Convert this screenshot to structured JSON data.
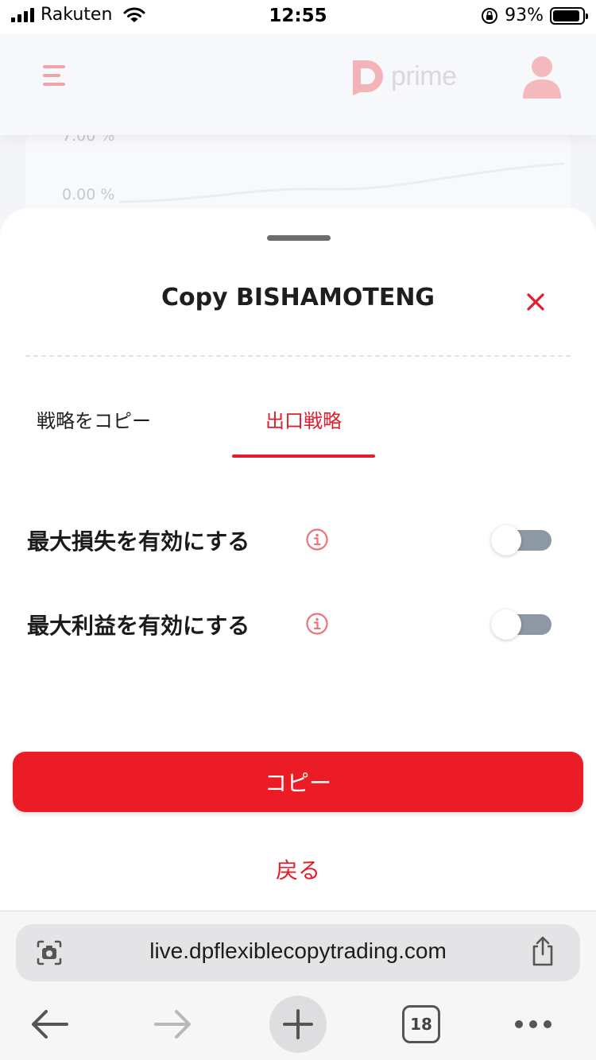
{
  "status_bar": {
    "carrier": "Rakuten",
    "time": "12:55",
    "battery_percent": "93%",
    "battery_level": 0.93,
    "icons": [
      "signal-icon",
      "wifi-icon",
      "orientation-lock-icon",
      "battery-icon"
    ]
  },
  "app_header": {
    "logo_text": "prime",
    "icons": [
      "menu-icon",
      "logo-icon",
      "user-icon"
    ]
  },
  "background_chart": {
    "axis_labels": [
      "7.00 %",
      "0.00 %"
    ]
  },
  "sheet": {
    "title": "Copy BISHAMOTENG",
    "close_icon": "close-icon",
    "tabs": [
      {
        "label": "戦略をコピー",
        "active": false
      },
      {
        "label": "出口戦略",
        "active": true
      }
    ],
    "options": [
      {
        "label": "最大損失を有効にする",
        "enabled": false,
        "info_icon": "info-icon"
      },
      {
        "label": "最大利益を有効にする",
        "enabled": false,
        "info_icon": "info-icon"
      }
    ],
    "copy_button": "コピー",
    "back_link": "戻る"
  },
  "browser": {
    "url": "live.dpflexiblecopytrading.com",
    "tab_count": "18",
    "icons": [
      "camera-search-icon",
      "share-icon",
      "back-arrow-icon",
      "forward-arrow-icon",
      "plus-icon",
      "tabs-icon",
      "more-icon"
    ]
  },
  "colors": {
    "accent": "#e31d2a",
    "button": "#ec1c26",
    "toggle_off_track": "#8d98a5"
  }
}
